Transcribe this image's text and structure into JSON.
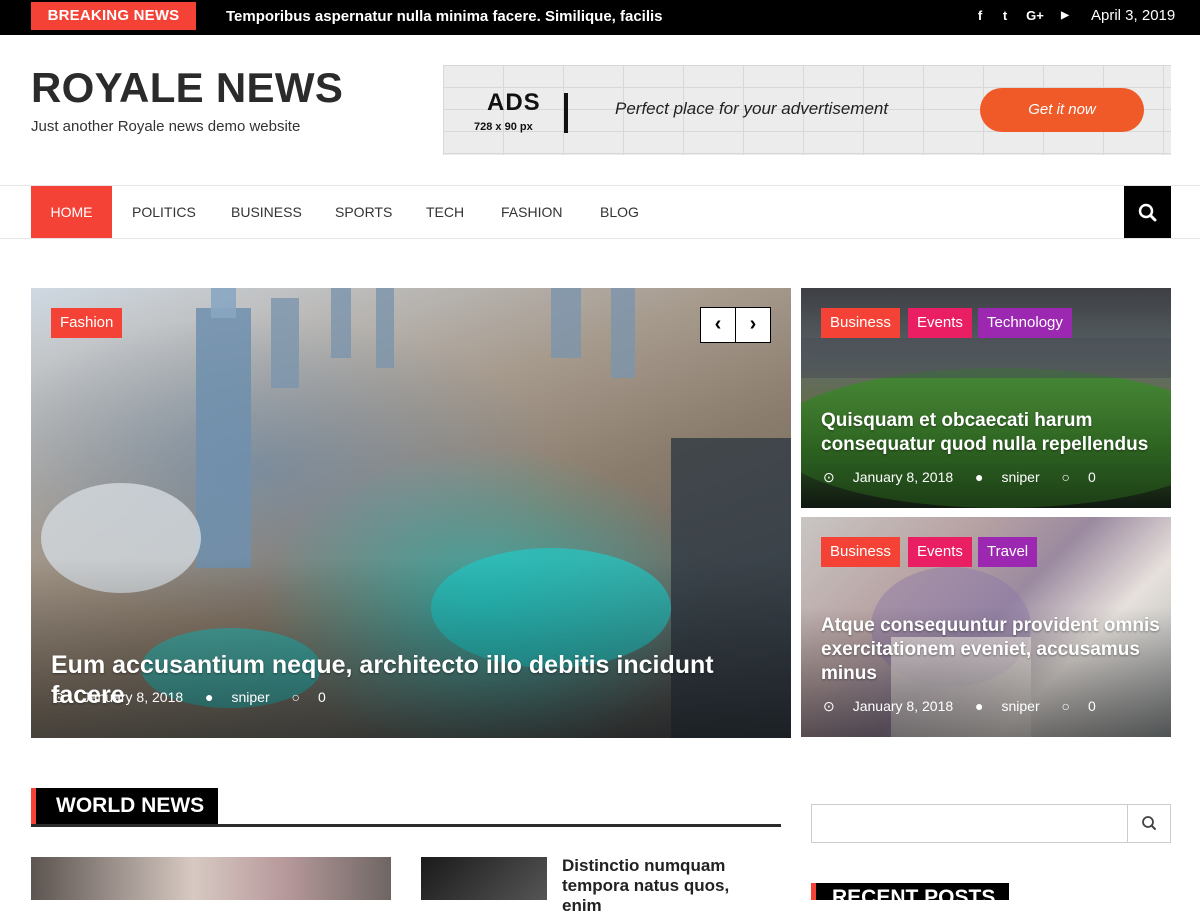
{
  "topbar": {
    "breaking_label": "BREAKING NEWS",
    "ticker_text": "Temporibus aspernatur nulla minima facere. Similique, facilis",
    "social": [
      {
        "icon": "facebook-icon",
        "glyph": "f"
      },
      {
        "icon": "twitter-icon",
        "glyph": "t"
      },
      {
        "icon": "google-plus-icon",
        "glyph": "G+"
      },
      {
        "icon": "youtube-icon",
        "glyph": "▶"
      }
    ],
    "date": "April 3, 2019"
  },
  "header": {
    "site_title": "ROYALE NEWS",
    "tagline": "Just another Royale news demo website",
    "ad": {
      "heading": "ADS",
      "size": "728 x 90 px",
      "text": "Perfect place for your advertisement",
      "button": "Get it now"
    }
  },
  "nav": {
    "items": [
      "HOME",
      "POLITICS",
      "BUSINESS",
      "SPORTS",
      "TECH",
      "FASHION",
      "BLOG"
    ],
    "active": "HOME"
  },
  "featured": {
    "main": {
      "category": "Fashion",
      "title": "Eum accusantium neque, architecto illo debitis incidunt facere",
      "date": "January 8, 2018",
      "author": "sniper",
      "comments": "0",
      "prev_glyph": "‹",
      "next_glyph": "›"
    },
    "side": [
      {
        "categories": [
          "Business",
          "Events",
          "Technology"
        ],
        "title": "Quisquam et obcaecati harum consequatur quod nulla repellendus",
        "date": "January 8, 2018",
        "author": "sniper",
        "comments": "0"
      },
      {
        "categories": [
          "Business",
          "Events",
          "Travel"
        ],
        "title": "Atque consequuntur provident omnis exercitationem eveniet, accusamus minus",
        "date": "January 8, 2018",
        "author": "sniper",
        "comments": "0"
      }
    ]
  },
  "world_news": {
    "heading": "WORLD NEWS",
    "second_title": "Distinctio numquam tempora natus quos, enim"
  },
  "sidebar": {
    "search_placeholder": "",
    "recent_heading": "RECENT POSTS"
  },
  "colors": {
    "accent": "#f44336",
    "tag_pink": "#e91e63",
    "tag_purple": "#9c27b0",
    "ad_button": "#ef5a28"
  }
}
